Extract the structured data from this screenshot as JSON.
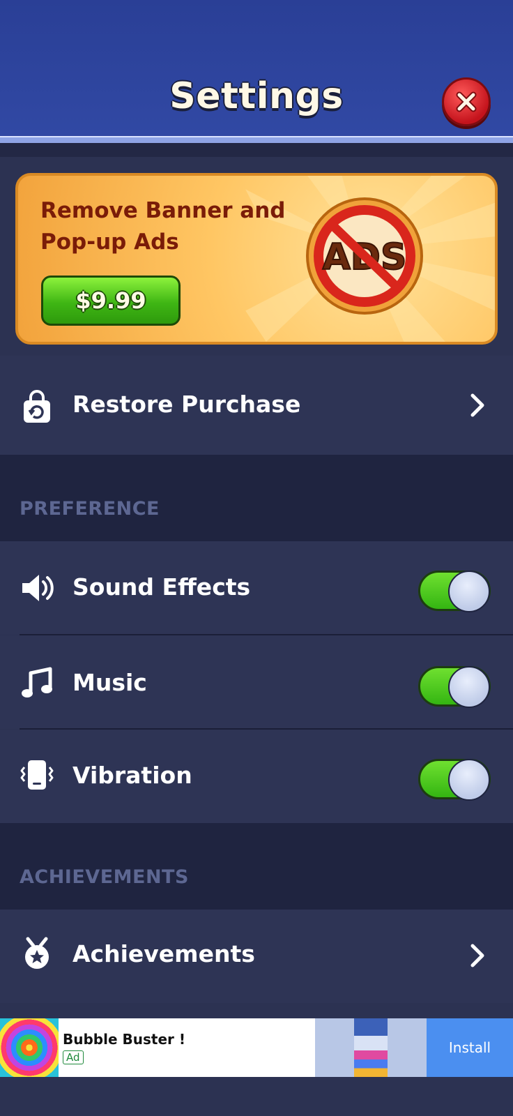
{
  "header": {
    "title": "Settings"
  },
  "promo": {
    "title_line1": "Remove Banner and",
    "title_line2": "Pop-up Ads",
    "price": "$9.99",
    "badge_text": "ADS"
  },
  "rows": {
    "restore": "Restore Purchase",
    "preference_section": "PREFERENCE",
    "sound": "Sound Effects",
    "music": "Music",
    "vibration": "Vibration",
    "achievements_section": "ACHIEVEMENTS",
    "achievements": "Achievements"
  },
  "toggles": {
    "sound": true,
    "music": true,
    "vibration": true
  },
  "ad": {
    "title": "Bubble Buster !",
    "tag": "Ad",
    "install": "Install"
  },
  "colors": {
    "accent_green": "#3fb614",
    "header_blue": "#2a3f96",
    "close_red": "#c4131c"
  }
}
